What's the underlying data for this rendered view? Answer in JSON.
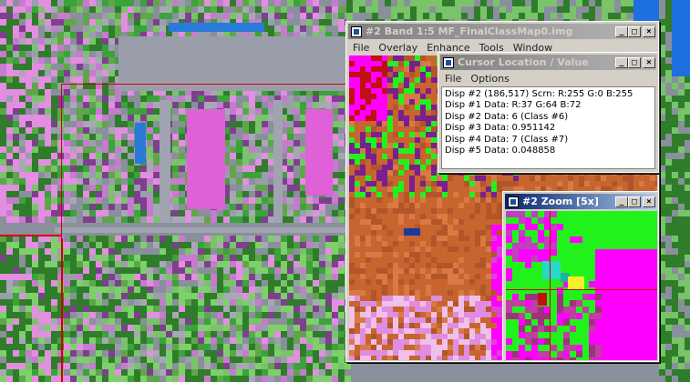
{
  "main_window": {
    "title": "#2 Band 1:5 MF_FinalClassMap0.img",
    "menu": [
      "File",
      "Overlay",
      "Enhance",
      "Tools",
      "Window"
    ]
  },
  "cursor_window": {
    "title": "Cursor Location / Value",
    "menu": [
      "File",
      "Options"
    ],
    "lines": [
      "Disp #2 (186,517) Scrn: R:255 G:0 B:255",
      "Disp #1 Data: R:37 G:64 B:72",
      "Disp #2 Data: 6 (Class #6)",
      "Disp #3 Data: 0.951142",
      "Disp #4 Data: 7 (Class #7)",
      "Disp #5 Data: 0.048858"
    ]
  },
  "zoom_window": {
    "title": "#2 Zoom [5x]"
  },
  "window_buttons": {
    "minimize": "_",
    "maximize": "□",
    "close": "×"
  },
  "colors": {
    "title_active": "#0a246a",
    "title_inactive": "#808080",
    "class_magenta": "#ff00ff",
    "class_green": "#22f21c",
    "class_orange": "#c8642e",
    "roi_red": "#d40000"
  }
}
